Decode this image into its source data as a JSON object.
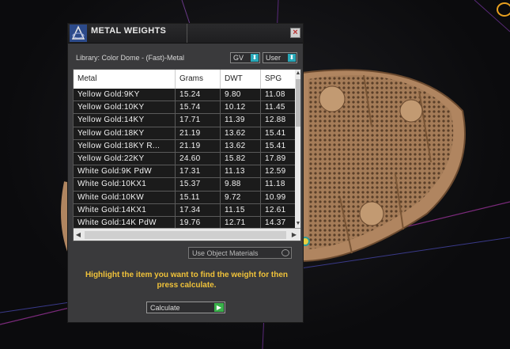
{
  "window": {
    "title": "METAL WEIGHTS",
    "close_glyph": "×"
  },
  "library": {
    "label": "Library: Color Dome - (Fast)-Metal"
  },
  "dropdowns": {
    "gv": {
      "value": "GV"
    },
    "user": {
      "value": "User"
    },
    "arrow_glyph": "⬍"
  },
  "table": {
    "columns": [
      "Metal",
      "Grams",
      "DWT",
      "SPG"
    ],
    "rows": [
      [
        "Yellow Gold:9KY",
        "15.24",
        "9.80",
        "11.08"
      ],
      [
        "Yellow Gold:10KY",
        "15.74",
        "10.12",
        "11.45"
      ],
      [
        "Yellow Gold:14KY",
        "17.71",
        "11.39",
        "12.88"
      ],
      [
        "Yellow Gold:18KY",
        "21.19",
        "13.62",
        "15.41"
      ],
      [
        "Yellow Gold:18KY R...",
        "21.19",
        "13.62",
        "15.41"
      ],
      [
        "Yellow Gold:22KY",
        "24.60",
        "15.82",
        "17.89"
      ],
      [
        "White Gold:9K PdW",
        "17.31",
        "11.13",
        "12.59"
      ],
      [
        "White Gold:10KX1",
        "15.37",
        "9.88",
        "11.18"
      ],
      [
        "White Gold:10KW",
        "15.11",
        "9.72",
        "10.99"
      ],
      [
        "White Gold:14KX1",
        "17.34",
        "11.15",
        "12.61"
      ],
      [
        "White Gold:14K PdW",
        "19.76",
        "12.71",
        "14.37"
      ]
    ],
    "scroll": {
      "up": "▲",
      "down": "▼",
      "left": "◀",
      "right": "▶"
    }
  },
  "use_object_materials": {
    "label": "Use Object Materials",
    "checked": false
  },
  "message": "Highlight the item you want to find the weight for then press calculate.",
  "calculate": {
    "label": "Calculate",
    "go_glyph": "▶"
  },
  "colors": {
    "accent": "#28a8b8",
    "message": "#f0c23a",
    "go": "#39b14a",
    "gold_model": "#b8926a"
  }
}
